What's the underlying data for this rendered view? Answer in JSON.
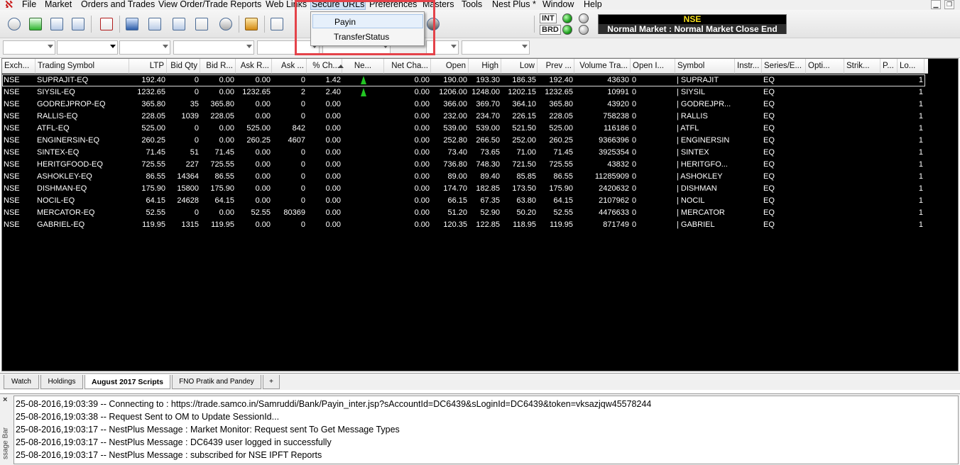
{
  "menubar": {
    "items": [
      "File",
      "Market",
      "Orders and Trades",
      "View Order/Trade Reports",
      "Web Links",
      "Secure URLs",
      "Preferences",
      "Masters",
      "Tools",
      "Nest Plus *",
      "Window",
      "Help"
    ],
    "minimize": "▁",
    "restore": "❐"
  },
  "dropdown": {
    "items": [
      "Payin",
      "TransferStatus"
    ]
  },
  "indicators": {
    "int_label": "INT",
    "brd_label": "BRD"
  },
  "market": {
    "exchange": "NSE",
    "status": "Normal Market : Normal Market Close End"
  },
  "grid": {
    "columns": [
      "Exch...",
      "Trading Symbol",
      "LTP",
      "Bid Qty",
      "Bid R...",
      "Ask R...",
      "Ask ...",
      "% Ch...",
      "Ne...",
      "Net Cha...",
      "Open",
      "High",
      "Low",
      "Prev ...",
      "Volume Tra...",
      "Open I...",
      "Symbol",
      "Instr...",
      "Series/E...",
      "Opti...",
      "Strik...",
      "P...",
      "Lo..."
    ],
    "rows": [
      [
        "NSE",
        "SUPRAJIT-EQ",
        "192.40",
        "0",
        "0.00",
        "0.00",
        "0",
        "1.42",
        "up",
        "0.00",
        "190.00",
        "193.30",
        "186.35",
        "192.40",
        "43630",
        "0",
        "| SUPRAJIT",
        "",
        "EQ",
        "",
        "",
        "",
        "1"
      ],
      [
        "NSE",
        "SIYSIL-EQ",
        "1232.65",
        "0",
        "0.00",
        "1232.65",
        "2",
        "2.40",
        "up",
        "0.00",
        "1206.00",
        "1248.00",
        "1202.15",
        "1232.65",
        "10991",
        "0",
        "| SIYSIL",
        "",
        "EQ",
        "",
        "",
        "",
        "1"
      ],
      [
        "NSE",
        "GODREJPROP-EQ",
        "365.80",
        "35",
        "365.80",
        "0.00",
        "0",
        "0.00",
        "",
        "0.00",
        "366.00",
        "369.70",
        "364.10",
        "365.80",
        "43920",
        "0",
        "| GODREJPR...",
        "",
        "EQ",
        "",
        "",
        "",
        "1"
      ],
      [
        "NSE",
        "RALLIS-EQ",
        "228.05",
        "1039",
        "228.05",
        "0.00",
        "0",
        "0.00",
        "",
        "0.00",
        "232.00",
        "234.70",
        "226.15",
        "228.05",
        "758238",
        "0",
        "| RALLIS",
        "",
        "EQ",
        "",
        "",
        "",
        "1"
      ],
      [
        "NSE",
        "ATFL-EQ",
        "525.00",
        "0",
        "0.00",
        "525.00",
        "842",
        "0.00",
        "",
        "0.00",
        "539.00",
        "539.00",
        "521.50",
        "525.00",
        "116186",
        "0",
        "| ATFL",
        "",
        "EQ",
        "",
        "",
        "",
        "1"
      ],
      [
        "NSE",
        "ENGINERSIN-EQ",
        "260.25",
        "0",
        "0.00",
        "260.25",
        "4607",
        "0.00",
        "",
        "0.00",
        "252.80",
        "266.50",
        "252.00",
        "260.25",
        "9366396",
        "0",
        "| ENGINERSIN",
        "",
        "EQ",
        "",
        "",
        "",
        "1"
      ],
      [
        "NSE",
        "SINTEX-EQ",
        "71.45",
        "51",
        "71.45",
        "0.00",
        "0",
        "0.00",
        "",
        "0.00",
        "73.40",
        "73.65",
        "71.00",
        "71.45",
        "3925354",
        "0",
        "| SINTEX",
        "",
        "EQ",
        "",
        "",
        "",
        "1"
      ],
      [
        "NSE",
        "HERITGFOOD-EQ",
        "725.55",
        "227",
        "725.55",
        "0.00",
        "0",
        "0.00",
        "",
        "0.00",
        "736.80",
        "748.30",
        "721.50",
        "725.55",
        "43832",
        "0",
        "| HERITGFO...",
        "",
        "EQ",
        "",
        "",
        "",
        "1"
      ],
      [
        "NSE",
        "ASHOKLEY-EQ",
        "86.55",
        "14364",
        "86.55",
        "0.00",
        "0",
        "0.00",
        "",
        "0.00",
        "89.00",
        "89.40",
        "85.85",
        "86.55",
        "11285909",
        "0",
        "| ASHOKLEY",
        "",
        "EQ",
        "",
        "",
        "",
        "1"
      ],
      [
        "NSE",
        "DISHMAN-EQ",
        "175.90",
        "15800",
        "175.90",
        "0.00",
        "0",
        "0.00",
        "",
        "0.00",
        "174.70",
        "182.85",
        "173.50",
        "175.90",
        "2420632",
        "0",
        "| DISHMAN",
        "",
        "EQ",
        "",
        "",
        "",
        "1"
      ],
      [
        "NSE",
        "NOCIL-EQ",
        "64.15",
        "24628",
        "64.15",
        "0.00",
        "0",
        "0.00",
        "",
        "0.00",
        "66.15",
        "67.35",
        "63.80",
        "64.15",
        "2107962",
        "0",
        "| NOCIL",
        "",
        "EQ",
        "",
        "",
        "",
        "1"
      ],
      [
        "NSE",
        "MERCATOR-EQ",
        "52.55",
        "0",
        "0.00",
        "52.55",
        "80369",
        "0.00",
        "",
        "0.00",
        "51.20",
        "52.90",
        "50.20",
        "52.55",
        "4476633",
        "0",
        "| MERCATOR",
        "",
        "EQ",
        "",
        "",
        "",
        "1"
      ],
      [
        "NSE",
        "GABRIEL-EQ",
        "119.95",
        "1315",
        "119.95",
        "0.00",
        "0",
        "0.00",
        "",
        "0.00",
        "120.35",
        "122.85",
        "118.95",
        "119.95",
        "871749",
        "0",
        "| GABRIEL",
        "",
        "EQ",
        "",
        "",
        "",
        "1"
      ]
    ]
  },
  "tabs": [
    "Watch",
    "Holdings",
    "August 2017 Scripts",
    "FNO Pratik and Pandey",
    "+"
  ],
  "messages": {
    "side_label": "ssage Bar",
    "close": "×",
    "lines": [
      "25-08-2016,19:03:39  -- Connecting to : https://trade.samco.in/Samruddi/Bank/Payin_inter.jsp?sAccountId=DC6439&sLoginId=DC6439&token=vksazjqw45578244",
      "25-08-2016,19:03:38  -- Request Sent to OM to Update SessionId...",
      "25-08-2016,19:03:17  -- NestPlus Message : Market Monitor: Request sent To Get Message Types",
      "25-08-2016,19:03:17  -- NestPlus Message : DC6439 user logged in successfully",
      "25-08-2016,19:03:17  -- NestPlus Message : subscribed for NSE IPFT Reports"
    ]
  },
  "colors": {
    "highlight": "#e4434a",
    "up": "#22c422",
    "market_exchange": "#f7e01c"
  },
  "icons": [
    "logo-icon",
    "toolbar-icons",
    "led-status-icons",
    "up-arrow-icon"
  ]
}
